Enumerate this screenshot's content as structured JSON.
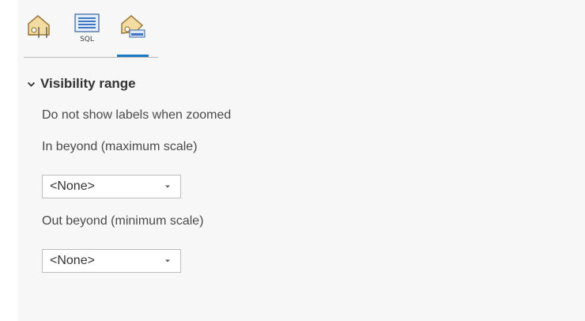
{
  "tabs": [
    {
      "name": "label-class-icon",
      "active": false
    },
    {
      "name": "sql-query-icon",
      "label": "SQL",
      "active": false
    },
    {
      "name": "visibility-range-icon",
      "active": true
    }
  ],
  "colors": {
    "accent": "#1a7ac4",
    "pane_background": "#f7f7f7",
    "text": "#4a4a4a"
  },
  "section": {
    "title": "Visibility range",
    "expanded": true,
    "description": "Do not show labels when zoomed",
    "max_scale": {
      "label": "In beyond (maximum scale)",
      "value": "<None>"
    },
    "min_scale": {
      "label": "Out beyond (minimum scale)",
      "value": "<None>"
    }
  }
}
